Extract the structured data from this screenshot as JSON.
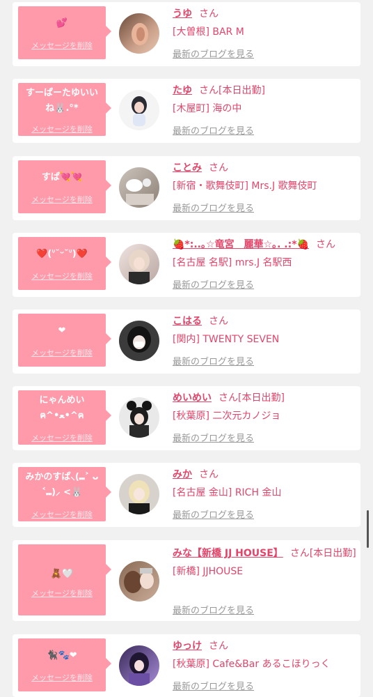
{
  "delete_label": "メッセージを削除",
  "blog_label": "最新のブログを見る",
  "san_label": "さん",
  "accent": "#e2456a",
  "bubble_color": "#ff9aab",
  "cards": [
    {
      "message": "💕",
      "name": "うゆ",
      "status": "",
      "shop": "[大曽根] BAR M",
      "avatar": "avatar-ear-photo"
    },
    {
      "message": "すーぱーたゆいいね🐰.°*",
      "name": "たゆ",
      "status": "[本日出勤]",
      "shop": "[木屋町] 海の中",
      "avatar": "avatar-girl-photo"
    },
    {
      "message": "すぱ💘💘",
      "name": "ことみ",
      "status": "",
      "shop": "[新宿・歌舞伎町] Mrs.J 歌舞伎町",
      "avatar": "avatar-girl-photo"
    },
    {
      "message": "❤️(ᐡ˘ᵕ˘ᐡ)❤️",
      "name": "🍓*:..｡☆竜宮　麗華☆｡. .:*🍓",
      "status": "",
      "shop": "[名古屋 名駅] mrs.J 名駅西",
      "avatar": "avatar-girl-photo"
    },
    {
      "message": "❤",
      "name": "こはる",
      "status": "",
      "shop": "[関内] TWENTY SEVEN",
      "avatar": "avatar-girl-photo"
    },
    {
      "message": "にゃんめい ฅ^•ﻌ•^ฅ",
      "name": "めいめい",
      "status": "[本日出勤]",
      "shop": "[秋葉原] 二次元カノジョ",
      "avatar": "avatar-girl-photo"
    },
    {
      "message": "みかのすぱ⸜(⑉˃ ᴗ ˂⑉)⸝ <🐰",
      "name": "みか",
      "status": "",
      "shop": "[名古屋 金山] RICH 金山",
      "avatar": "avatar-girl-photo"
    },
    {
      "message": "🧸🤍",
      "name": "みな【新橋 JJ HOUSE】",
      "status": "[本日出勤]",
      "shop": "[新橋] JJHOUSE",
      "avatar": "avatar-girl-photo"
    },
    {
      "message": "🐈‍⬛🐾❤",
      "name": "ゆっけ",
      "status": "",
      "shop": "[秋葉原] Cafe&Bar あるこほりっく",
      "avatar": "avatar-girl-photo"
    }
  ]
}
